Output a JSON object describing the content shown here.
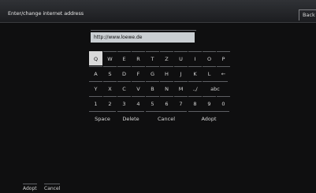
{
  "title": "Enter/change internet address",
  "back_label": "Back",
  "url_value": "http://www.loewe.de",
  "keys": {
    "row1": [
      "Q",
      "W",
      "E",
      "R",
      "T",
      "Z",
      "U",
      "I",
      "O",
      "P"
    ],
    "row2": [
      "A",
      "S",
      "D",
      "F",
      "G",
      "H",
      "J",
      "K",
      "L",
      "←"
    ],
    "row3": [
      "Y",
      "X",
      "C",
      "V",
      "B",
      "N",
      "M",
      ".,/",
      "abc"
    ],
    "row4": [
      "1",
      "2",
      "3",
      "4",
      "5",
      "6",
      "7",
      "8",
      "9",
      "0"
    ],
    "row5": [
      "Space",
      "Delete",
      "Cancel",
      "Adopt"
    ]
  },
  "footer": {
    "adopt": "Adopt",
    "cancel": "Cancel"
  }
}
